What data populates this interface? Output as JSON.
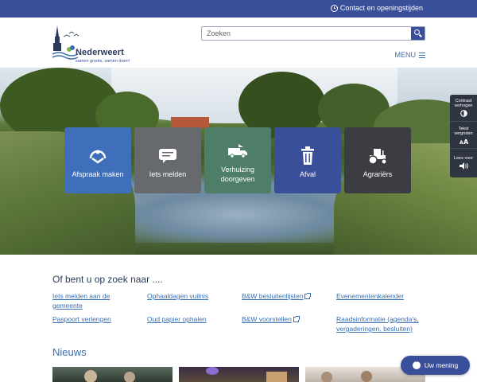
{
  "topbar": {
    "contact_label": "Contact en openingstijden"
  },
  "header": {
    "logo_name": "Nederweert",
    "logo_slogan": "samen groots, samen doen!",
    "search_placeholder": "Zoeken",
    "menu_label": "MENU"
  },
  "tiles": [
    {
      "label": "Afspraak maken",
      "icon": "handshake-icon",
      "color": "#3f6fba"
    },
    {
      "label": "Iets melden",
      "icon": "speech-bubble-icon",
      "color": "#66696e"
    },
    {
      "label": "Verhuizing doorgeven",
      "icon": "moving-truck-icon",
      "color": "#4f7e68"
    },
    {
      "label": "Afval",
      "icon": "trash-can-icon",
      "color": "#3a4f9a"
    },
    {
      "label": "Agrariërs",
      "icon": "tractor-icon",
      "color": "#3b3d42"
    }
  ],
  "accessibility": {
    "contrast_label": "Contrast verhogen",
    "text_label": "Tekst vergroten",
    "read_label": "Lees voor"
  },
  "quicklinks": {
    "title": "Of bent u op zoek naar ....",
    "items": [
      "Iets melden aan de gemeente",
      "Ophaaldagen vuilnis",
      "B&W besluitenlijsten",
      "Evenementenkalender",
      "Paspoort verlengen",
      "Oud papier ophalen",
      "B&W voorstellen",
      "Raadsinformatie (agenda's, vergaderingen, besluiten)"
    ]
  },
  "news": {
    "title": "Nieuws"
  },
  "feedback": {
    "label": "Uw mening"
  }
}
